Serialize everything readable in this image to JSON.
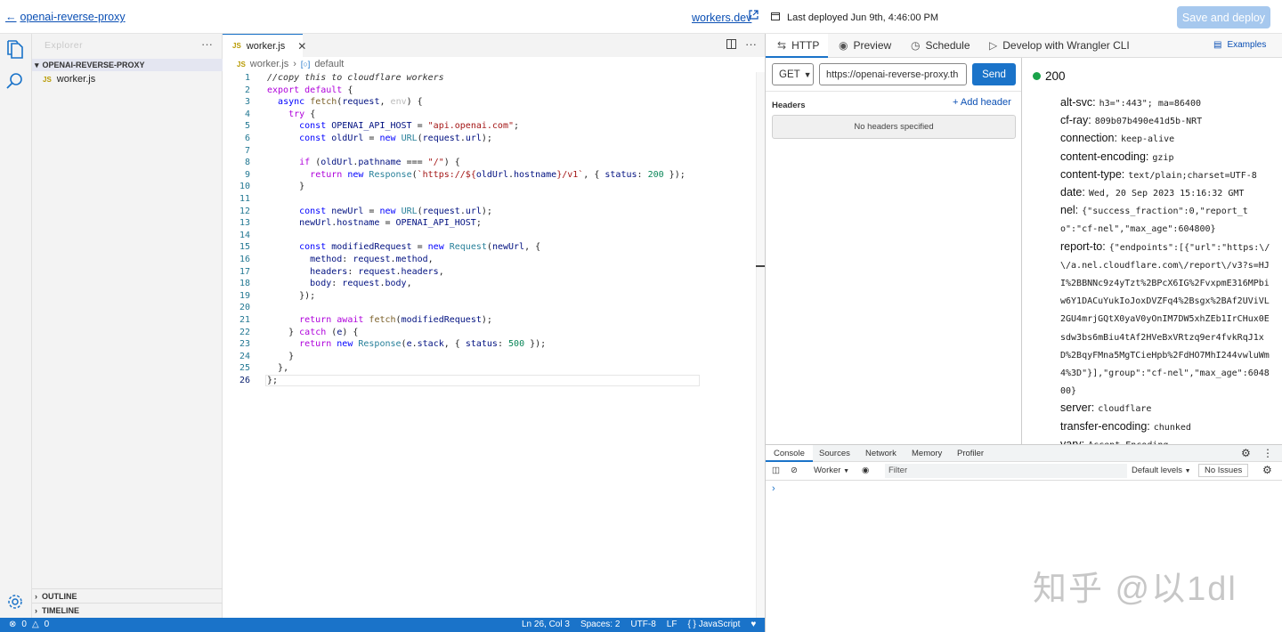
{
  "topbar": {
    "back_label": "openai-reverse-proxy",
    "workers_link": "workers.dev",
    "last_deployed": "Last deployed Jun 9th, 4:46:00 PM",
    "save_label": "Save and deploy"
  },
  "sidebar": {
    "explorer_title": "Explorer",
    "project": "OPENAI-REVERSE-PROXY",
    "file": "worker.js",
    "outline": "OUTLINE",
    "timeline": "TIMELINE"
  },
  "editor": {
    "tab_label": "worker.js",
    "breadcrumb_file": "worker.js",
    "breadcrumb_symbol": "default",
    "line_numbers": [
      "1",
      "2",
      "3",
      "4",
      "5",
      "6",
      "7",
      "8",
      "9",
      "10",
      "11",
      "12",
      "13",
      "14",
      "15",
      "16",
      "17",
      "18",
      "19",
      "20",
      "21",
      "22",
      "23",
      "24",
      "25",
      "26"
    ]
  },
  "statusbar": {
    "errors": "0",
    "warnings": "0",
    "position": "Ln 26, Col 3",
    "spaces": "Spaces: 2",
    "encoding": "UTF-8",
    "eol": "LF",
    "language": "JavaScript"
  },
  "right": {
    "tabs": {
      "http": "HTTP",
      "preview": "Preview",
      "schedule": "Schedule",
      "wrangler": "Develop with Wrangler CLI"
    },
    "examples": "Examples",
    "method": "GET",
    "url": "https://openai-reverse-proxy.th",
    "send": "Send",
    "headers_label": "Headers",
    "add_header": "Add header",
    "no_headers": "No headers specified",
    "status_code": "200",
    "response_headers": [
      {
        "k": "alt-svc:",
        "v": "h3=\":443\"; ma=86400"
      },
      {
        "k": "cf-ray:",
        "v": "809b07b490e41d5b-NRT"
      },
      {
        "k": "connection:",
        "v": "keep-alive"
      },
      {
        "k": "content-encoding:",
        "v": "gzip"
      },
      {
        "k": "content-type:",
        "v": "text/plain;charset=UTF-8"
      },
      {
        "k": "date:",
        "v": "Wed, 20 Sep 2023 15:16:32 GMT"
      },
      {
        "k": "nel:",
        "v": "{\"success_fraction\":0,\"report_to\":\"cf-nel\",\"max_age\":604800}"
      },
      {
        "k": "report-to:",
        "v": "{\"endpoints\":[{\"url\":\"https:\\/\\/a.nel.cloudflare.com\\/report\\/v3?s=HJI%2BBNNc9z4yTzt%2BPcX6IG%2FvxpmE316MPbiw6Y1DACuYukIoJoxDVZFq4%2Bsgx%2BAf2UViVL2GU4mrjGQtX0yaV0yOnIM7DW5xhZEb1IrCHux0Esdw3bs6mBiu4tAf2HVeBxVRtzq9er4fvkRqJ1xD%2BqyFMna5MgTCieHpb%2FdHO7MhI244vwluWm4%3D\"}],\"group\":\"cf-nel\",\"max_age\":604800}"
      },
      {
        "k": "server:",
        "v": "cloudflare"
      },
      {
        "k": "transfer-encoding:",
        "v": "chunked"
      },
      {
        "k": "vary:",
        "v": "Accept-Encoding"
      }
    ]
  },
  "devtools": {
    "tabs": {
      "console": "Console",
      "sources": "Sources",
      "network": "Network",
      "memory": "Memory",
      "profiler": "Profiler"
    },
    "context": "Worker",
    "filter_placeholder": "Filter",
    "levels": "Default levels",
    "issues": "No Issues"
  },
  "watermark": "知乎 @以1dl"
}
